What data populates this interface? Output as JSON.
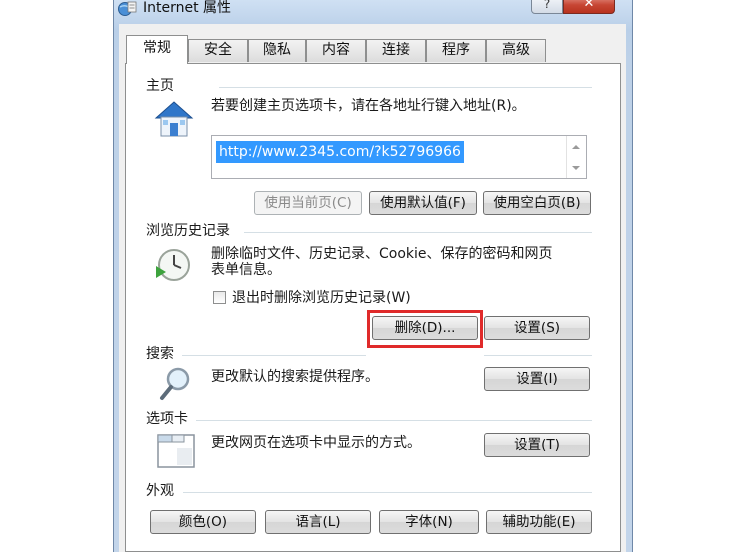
{
  "window": {
    "title": "Internet 属性",
    "help_label": "?",
    "close_label": "✕"
  },
  "tabs": [
    {
      "label": "常规",
      "active": true
    },
    {
      "label": "安全"
    },
    {
      "label": "隐私"
    },
    {
      "label": "内容"
    },
    {
      "label": "连接"
    },
    {
      "label": "程序"
    },
    {
      "label": "高级"
    }
  ],
  "homepage": {
    "heading": "主页",
    "description": "若要创建主页选项卡，请在各地址行键入地址(R)。",
    "url": "http://www.2345.com/?k52796966",
    "use_current_label": "使用当前页(C)",
    "use_default_label": "使用默认值(F)",
    "use_blank_label": "使用空白页(B)"
  },
  "history": {
    "heading": "浏览历史记录",
    "description_line1": "删除临时文件、历史记录、Cookie、保存的密码和网页",
    "description_line2": "表单信息。",
    "checkbox_label": "退出时删除浏览历史记录(W)",
    "checkbox_checked": false,
    "delete_label": "删除(D)...",
    "settings_label": "设置(S)"
  },
  "search": {
    "heading": "搜索",
    "description": "更改默认的搜索提供程序。",
    "settings_label": "设置(I)"
  },
  "tabs_section": {
    "heading": "选项卡",
    "description": "更改网页在选项卡中显示的方式。",
    "settings_label": "设置(T)"
  },
  "appearance": {
    "heading": "外观",
    "colors_label": "颜色(O)",
    "languages_label": "语言(L)",
    "fonts_label": "字体(N)",
    "accessibility_label": "辅助功能(E)"
  },
  "colors": {
    "highlight": "#e02a2a",
    "selection": "#3399ff"
  }
}
